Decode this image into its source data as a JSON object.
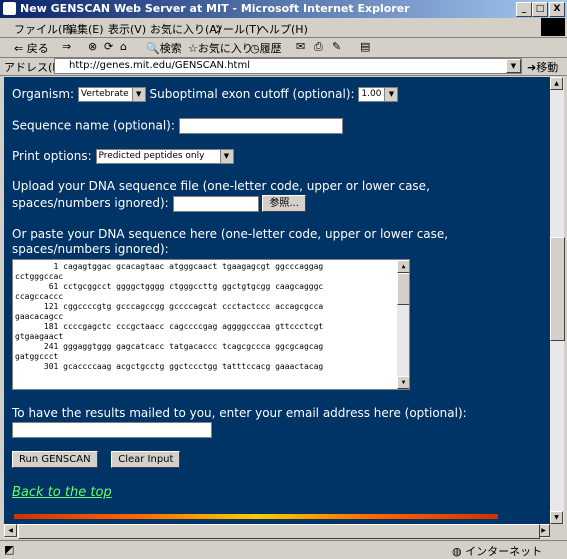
{
  "window": {
    "title": "New GENSCAN Web Server at MIT - Microsoft Internet Explorer",
    "min": "_",
    "max": "□",
    "close": "X"
  },
  "menu": [
    "ファイル(F)",
    "編集(E)",
    "表示(V)",
    "お気に入り(A)",
    "ツール(T)",
    "ヘルプ(H)"
  ],
  "toolbar": {
    "back": "⇐ 戻る",
    "forward": "⇒",
    "search": "検索",
    "favorites": "お気に入り",
    "history": "履歴"
  },
  "address": {
    "label": "アドレス(D)",
    "url": "http://genes.mit.edu/GENSCAN.html",
    "go": "移動"
  },
  "form": {
    "organism_label": "Organism:",
    "organism_value": "Vertebrate",
    "suboptimal_label": "Suboptimal exon cutoff (optional):",
    "suboptimal_value": "1.00",
    "seqname_label": "Sequence name (optional):",
    "print_label": "Print options:",
    "print_value": "Predicted peptides only",
    "upload_line1": "Upload your DNA sequence file (one-letter code, upper or lower case,",
    "upload_line2": "spaces/numbers ignored):",
    "browse": "参照...",
    "paste_line1": "Or paste your DNA sequence here (one-letter code, upper or lower case,",
    "paste_line2": "spaces/numbers ignored):",
    "sequence": "        1 cagagtggac gcacagtaac atgggcaact tgaagagcgt ggcccaggag\ncctgggccac\n       61 cctgcggcct ggggctgggg ctgggccttg ggctgtgcgg caagcagggc\nccagccaccc\n      121 cggccccgtg gcccagccgg gccccagcat ccctactccc accagcgcca\ngaacacagcc\n      181 ccccgagctc cccgctaacc cagccccgag aggggcccaa gttccctcgt\ngtgaagaact\n      241 gggaggtggg gagcatcacc tatgacaccc tcagcgccca ggcgcagcag\ngatggccct\n      301 gcaccccaag acgctgcctg ggctccctgg tatttccacg gaaactacag",
    "email_label": "To have the results mailed to you, enter your email address here (optional):",
    "run": "Run GENSCAN",
    "clear": "Clear Input",
    "back_top": "Back to the top"
  },
  "status": {
    "zone": "インターネット"
  }
}
